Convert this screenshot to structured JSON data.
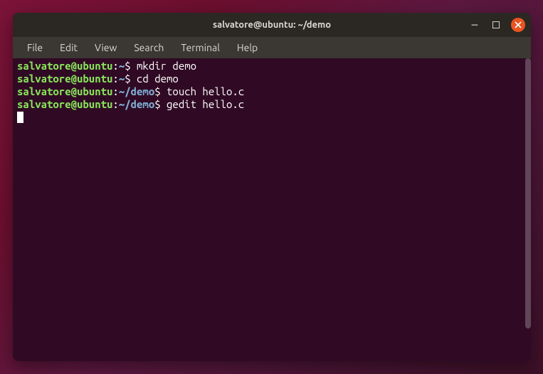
{
  "window": {
    "title": "salvatore@ubuntu: ~/demo"
  },
  "menu": {
    "items": [
      "File",
      "Edit",
      "View",
      "Search",
      "Terminal",
      "Help"
    ]
  },
  "prompt": {
    "user_host": "salvatore@ubuntu",
    "colon": ":",
    "home": "~",
    "demo_path": "~/demo",
    "dollar": "$"
  },
  "lines": [
    {
      "path": "~",
      "command": "mkdir demo"
    },
    {
      "path": "~",
      "command": "cd demo"
    },
    {
      "path": "~/demo",
      "command": "touch hello.c"
    },
    {
      "path": "~/demo",
      "command": "gedit hello.c"
    }
  ]
}
